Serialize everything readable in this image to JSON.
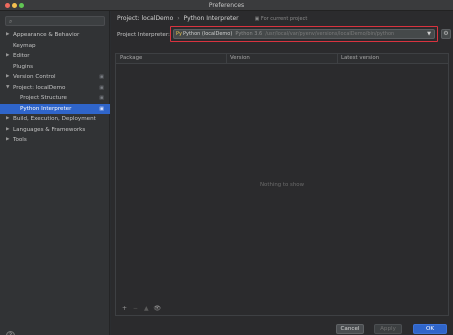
{
  "window": {
    "title": "Preferences"
  },
  "sidebar": {
    "search_icon": "search-icon",
    "items": [
      {
        "label": "Appearance & Behavior",
        "expandable": true
      },
      {
        "label": "Keymap",
        "expandable": false
      },
      {
        "label": "Editor",
        "expandable": true
      },
      {
        "label": "Plugins",
        "expandable": false
      },
      {
        "label": "Version Control",
        "expandable": true
      },
      {
        "label": "Project: localDemo",
        "expandable": true,
        "expanded": true
      },
      {
        "label": "Project Structure",
        "child": true
      },
      {
        "label": "Python Interpreter",
        "child": true,
        "selected": true
      },
      {
        "label": "Build, Execution, Deployment",
        "expandable": true
      },
      {
        "label": "Languages & Frameworks",
        "expandable": true
      },
      {
        "label": "Tools",
        "expandable": true
      }
    ],
    "help_label": "?"
  },
  "breadcrumb": {
    "parent": "Project: localDemo",
    "separator": "›",
    "current": "Python Interpreter",
    "scope": "For current project"
  },
  "interpreter": {
    "label": "Project Interpreter:",
    "badge": "Py",
    "name": "Python (localDemo)",
    "version": "Python 3.6",
    "path": "/usr/local/var/pyenv/versions/localDemo/bin/python",
    "dropdown_icon": "▼",
    "gear_icon": "⚙"
  },
  "packages_table": {
    "columns": [
      "Package",
      "Version",
      "Latest version"
    ],
    "rows": [],
    "empty_text": "Nothing to show",
    "toolbar": [
      "+",
      "−",
      "▲",
      "👁"
    ]
  },
  "footer": {
    "cancel": "Cancel",
    "apply": "Apply",
    "ok": "OK"
  },
  "colors": {
    "selection": "#2f65ca",
    "highlight_border": "#d9333f",
    "background": "#2b2b2d"
  }
}
